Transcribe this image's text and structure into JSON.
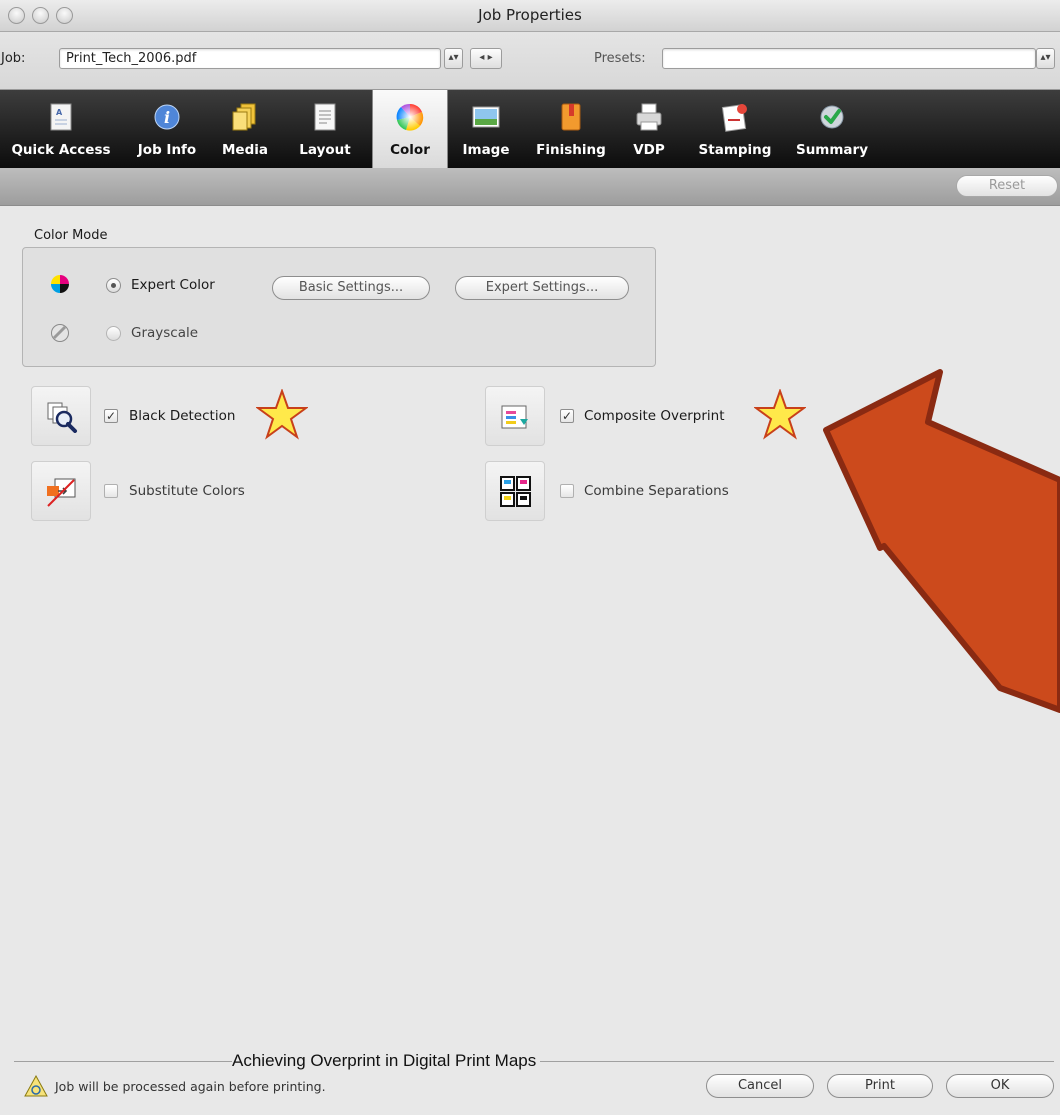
{
  "window": {
    "title": "Job Properties"
  },
  "jobbar": {
    "job_label": "Job:",
    "job_value": "Print_Tech_2006.pdf",
    "presets_label": "Presets:",
    "presets_value": ""
  },
  "tabs": [
    {
      "label": "Quick Access",
      "icon": "quick-access-icon"
    },
    {
      "label": "Job Info",
      "icon": "info-icon"
    },
    {
      "label": "Media",
      "icon": "media-icon"
    },
    {
      "label": "Layout",
      "icon": "layout-icon"
    },
    {
      "label": "Color",
      "icon": "color-wheel-icon",
      "active": true
    },
    {
      "label": "Image",
      "icon": "image-icon"
    },
    {
      "label": "Finishing",
      "icon": "finishing-icon"
    },
    {
      "label": "VDP",
      "icon": "printer-icon"
    },
    {
      "label": "Stamping",
      "icon": "stamping-icon"
    },
    {
      "label": "Summary",
      "icon": "checkmark-icon"
    }
  ],
  "toolbar": {
    "reset_label": "Reset"
  },
  "color_mode": {
    "group_label": "Color Mode",
    "expert_color_label": "Expert Color",
    "grayscale_label": "Grayscale",
    "selected": "Expert Color",
    "basic_settings_label": "Basic Settings...",
    "expert_settings_label": "Expert Settings..."
  },
  "options": {
    "black_detection": {
      "label": "Black Detection",
      "checked": true
    },
    "composite_overprint": {
      "label": "Composite Overprint",
      "checked": true
    },
    "substitute_colors": {
      "label": "Substitute Colors",
      "checked": false
    },
    "combine_separations": {
      "label": "Combine Separations",
      "checked": false
    }
  },
  "annotation": {
    "caption": "Achieving Overprint in Digital Print Maps"
  },
  "footer": {
    "message": "Job will be processed again before printing.",
    "cancel_label": "Cancel",
    "print_label": "Print",
    "ok_label": "OK"
  },
  "colors": {
    "arrow_fill": "#cc4a1c",
    "arrow_stroke": "#8a2a12",
    "star_fill": "#ffe94a",
    "star_stroke": "#c8401a"
  }
}
